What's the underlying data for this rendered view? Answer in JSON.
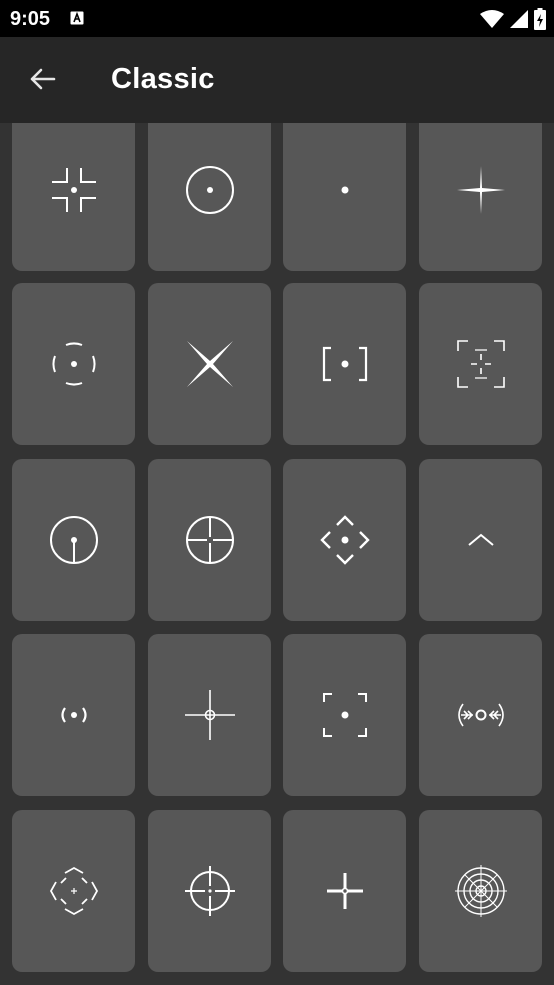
{
  "status_bar": {
    "time": "9:05",
    "notification_icon": "a-notification-icon",
    "wifi_icon": "wifi-icon",
    "signal_icon": "cell-signal-icon",
    "battery_icon": "battery-charging-icon"
  },
  "app_bar": {
    "back_icon": "arrow-back-icon",
    "title": "Classic"
  },
  "colors": {
    "status_bar_bg": "#000000",
    "app_bar_bg": "#262626",
    "background": "#333333",
    "tile_bg": "#575757",
    "glyph": "#ffffff"
  },
  "crosshairs": [
    {
      "icon": "corner-brackets-dot-icon"
    },
    {
      "icon": "circle-dot-icon"
    },
    {
      "icon": "dot-icon"
    },
    {
      "icon": "thin-cross-icon"
    },
    {
      "icon": "broken-circle-dot-icon"
    },
    {
      "icon": "x-cross-icon"
    },
    {
      "icon": "square-brackets-dot-icon"
    },
    {
      "icon": "bracket-cross-icon"
    },
    {
      "icon": "circle-dot-stem-icon"
    },
    {
      "icon": "circle-cross-icon"
    },
    {
      "icon": "diamond-chevrons-dot-icon"
    },
    {
      "icon": "chevron-up-icon"
    },
    {
      "icon": "parentheses-dot-icon"
    },
    {
      "icon": "cross-small-circle-icon"
    },
    {
      "icon": "corner-brackets-square-dot-icon"
    },
    {
      "icon": "arrow-ring-icon"
    },
    {
      "icon": "broken-diamond-cross-icon"
    },
    {
      "icon": "circle-cross-target-icon"
    },
    {
      "icon": "bold-cross-ring-icon"
    },
    {
      "icon": "concentric-reticle-icon"
    }
  ]
}
